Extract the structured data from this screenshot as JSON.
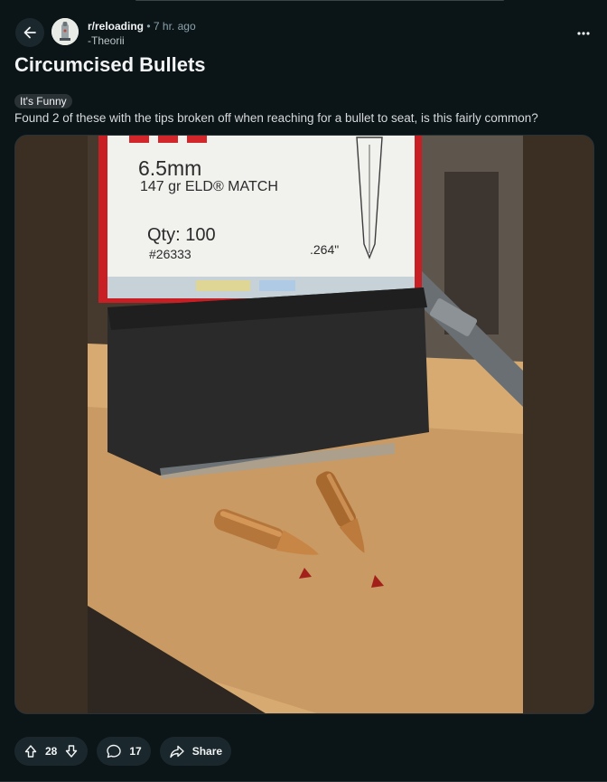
{
  "post": {
    "subreddit": "r/reloading",
    "separator": "•",
    "time": "7 hr. ago",
    "author": "-Theorii",
    "title": "Circumcised Bullets",
    "flair": "It's Funny",
    "body": "Found 2 of these with the tips broken off when reaching for a bullet to seat, is this fairly common?"
  },
  "image": {
    "box_caliber": "6.5mm",
    "box_bullet": "147 gr ELD® MATCH",
    "box_qty": "Qty: 100",
    "box_part": "#26333",
    "box_diameter": ".264\""
  },
  "actions": {
    "upvotes": "28",
    "comments": "17",
    "share_label": "Share"
  },
  "colors": {
    "background": "#0b1416",
    "button_bg": "#1a282d",
    "muted_text": "#8ba2ad"
  }
}
